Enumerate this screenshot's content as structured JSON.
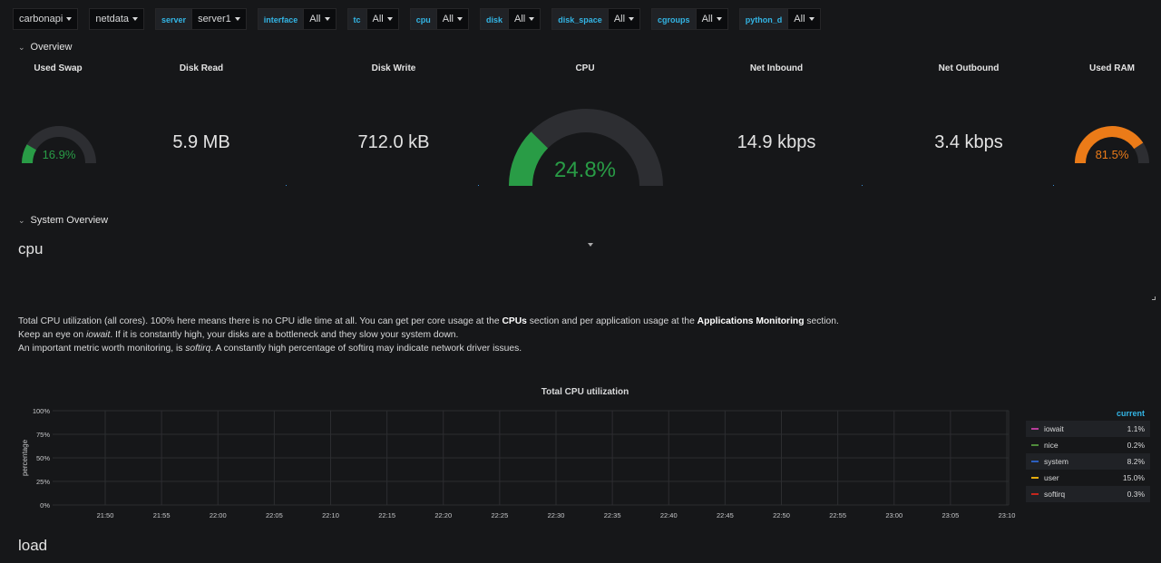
{
  "variables": [
    {
      "label": "",
      "value": "carbonapi"
    },
    {
      "label": "",
      "value": "netdata"
    },
    {
      "label": "server",
      "value": "server1"
    },
    {
      "label": "interface",
      "value": "All"
    },
    {
      "label": "tc",
      "value": "All"
    },
    {
      "label": "cpu",
      "value": "All"
    },
    {
      "label": "disk",
      "value": "All"
    },
    {
      "label": "disk_space",
      "value": "All"
    },
    {
      "label": "cgroups",
      "value": "All"
    },
    {
      "label": "python_d",
      "value": "All"
    }
  ],
  "rows": {
    "overview": "Overview",
    "system_overview": "System Overview"
  },
  "stats": {
    "used_swap": {
      "title": "Used Swap",
      "value": "16.9%",
      "percent": 16.9,
      "color": "#299c46"
    },
    "disk_read": {
      "title": "Disk Read",
      "value": "5.9 MB"
    },
    "disk_write": {
      "title": "Disk Write",
      "value": "712.0 kB"
    },
    "cpu": {
      "title": "CPU",
      "value": "24.8%",
      "percent": 24.8,
      "color": "#299c46"
    },
    "net_inbound": {
      "title": "Net Inbound",
      "value": "14.9 kbps"
    },
    "net_outbound": {
      "title": "Net Outbound",
      "value": "3.4 kbps"
    },
    "used_ram": {
      "title": "Used RAM",
      "value": "81.5%",
      "percent": 81.5,
      "color": "#eb7b18"
    }
  },
  "sections": {
    "cpu": "cpu",
    "load": "load"
  },
  "description": {
    "line1_pre": "Total CPU utilization (all cores). 100% here means there is no CPU idle time at all. You can get per core usage at the ",
    "line1_b1": "CPUs",
    "line1_mid": " section and per application usage at the ",
    "line1_b2": "Applications Monitoring",
    "line1_post": " section.",
    "line2_pre": "Keep an eye on ",
    "line2_i": "iowait",
    "line2_post": ". If it is constantly high, your disks are a bottleneck and they slow your system down.",
    "line3_pre": "An important metric worth monitoring, is ",
    "line3_i": "softirq",
    "line3_post": ". A constantly high percentage of softirq may indicate network driver issues."
  },
  "chart_data": {
    "type": "line",
    "title": "Total CPU utilization",
    "ylabel": "percentage",
    "ylim": [
      0,
      100
    ],
    "yticks": [
      "0%",
      "25%",
      "50%",
      "75%",
      "100%"
    ],
    "categories": [
      "21:50",
      "21:55",
      "22:00",
      "22:05",
      "22:10",
      "22:15",
      "22:20",
      "22:25",
      "22:30",
      "22:35",
      "22:40",
      "22:45",
      "22:50",
      "22:55",
      "23:00",
      "23:05",
      "23:10"
    ],
    "grid": true,
    "legend_header": "current",
    "series": [
      {
        "name": "iowait",
        "current": "1.1%",
        "color": "#b83e9b"
      },
      {
        "name": "nice",
        "current": "0.2%",
        "color": "#4f8c3b"
      },
      {
        "name": "system",
        "current": "8.2%",
        "color": "#2c5fbf"
      },
      {
        "name": "user",
        "current": "15.0%",
        "color": "#e5ac0e"
      },
      {
        "name": "softirq",
        "current": "0.3%",
        "color": "#c4261d"
      }
    ]
  }
}
